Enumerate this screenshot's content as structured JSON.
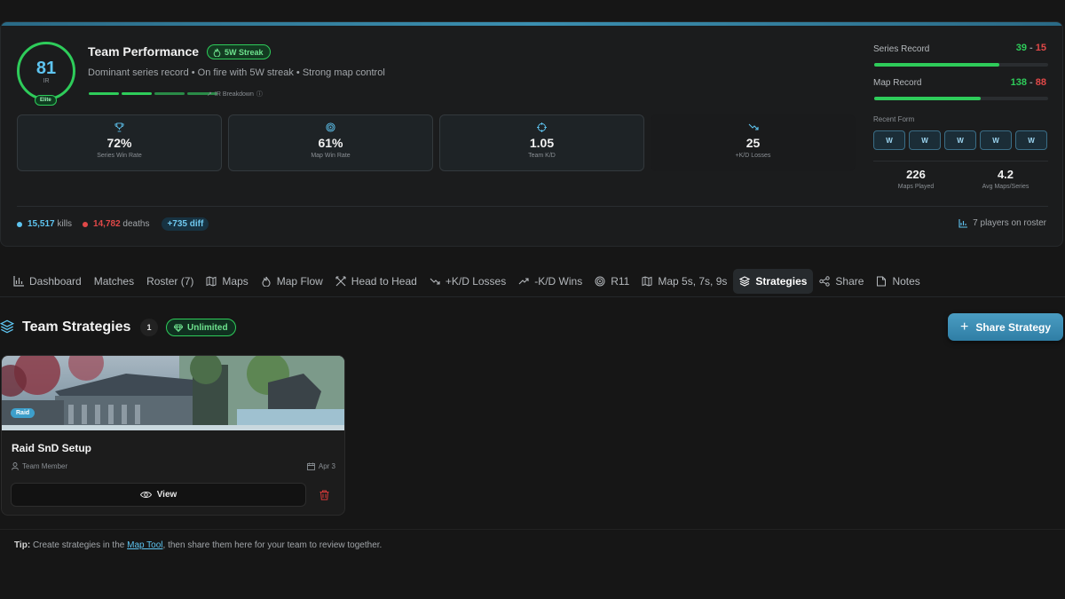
{
  "overview": {
    "ir": {
      "value": "81",
      "label": "IR",
      "badge": "Elite"
    },
    "title": "Team Performance",
    "streak_badge": "5W Streak",
    "subtitle": "Dominant series record • On fire with 5W streak • Strong map control",
    "ir_breakdown": "IR Breakdown",
    "stats": [
      {
        "icon": "trophy-icon",
        "value": "72%",
        "label": "Series Win Rate"
      },
      {
        "icon": "target-icon",
        "value": "61%",
        "label": "Map Win Rate"
      },
      {
        "icon": "crosshair-icon",
        "value": "1.05",
        "label": "Team K/D"
      },
      {
        "icon": "trend-down-icon",
        "value": "25",
        "label": "+K/D Losses"
      }
    ],
    "kills": {
      "value": "15,517",
      "label": "kills",
      "color": "#5ec4f0"
    },
    "deaths": {
      "value": "14,782",
      "label": "deaths",
      "color": "#e04848"
    },
    "diff": "+735 diff",
    "roster": "7 players on roster",
    "series_record": {
      "label": "Series Record",
      "wins": "39",
      "losses": "15",
      "fill": 0.72
    },
    "map_record": {
      "label": "Map Record",
      "wins": "138",
      "losses": "88",
      "fill": 0.61
    },
    "recent_form": {
      "label": "Recent Form",
      "results": [
        "W",
        "W",
        "W",
        "W",
        "W"
      ]
    },
    "maps_played": {
      "value": "226",
      "label": "Maps Played"
    },
    "avg_maps": {
      "value": "4.2",
      "label": "Avg Maps/Series"
    }
  },
  "tabs": [
    {
      "icon": "chart-icon",
      "label": "Dashboard"
    },
    {
      "icon": "",
      "label": "Matches"
    },
    {
      "icon": "",
      "label": "Roster (7)"
    },
    {
      "icon": "map-icon",
      "label": "Maps"
    },
    {
      "icon": "flame-icon",
      "label": "Map Flow"
    },
    {
      "icon": "swords-icon",
      "label": "Head to Head"
    },
    {
      "icon": "trend-down-icon",
      "label": "+K/D Losses"
    },
    {
      "icon": "trend-up-icon",
      "label": "-K/D Wins"
    },
    {
      "icon": "target-icon",
      "label": "R11"
    },
    {
      "icon": "map-icon",
      "label": "Map 5s, 7s, 9s"
    },
    {
      "icon": "layers-icon",
      "label": "Strategies",
      "active": true
    },
    {
      "icon": "share-icon",
      "label": "Share"
    },
    {
      "icon": "note-icon",
      "label": "Notes"
    }
  ],
  "strategies": {
    "title": "Team Strategies",
    "count": "1",
    "plan_badge": "Unlimited",
    "share_button": "Share Strategy",
    "items": [
      {
        "map": "Raid",
        "name": "Raid SnD Setup",
        "author": "Team Member",
        "date": "Apr 3",
        "view_label": "View"
      }
    ],
    "tip": {
      "prefix": "Tip:",
      "before": "Create strategies in the",
      "link": "Map Tool",
      "after": ", then share them here for your team to review together."
    }
  },
  "colors": {
    "accent": "#5ec4f0",
    "win": "#2ecc5a",
    "loss": "#e04848",
    "background": "#161616"
  }
}
